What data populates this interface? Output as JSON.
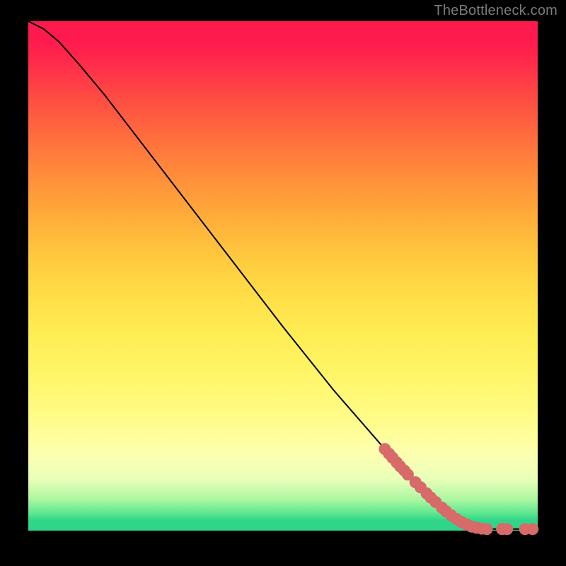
{
  "watermark": "TheBottleneck.com",
  "colors": {
    "curve": "#000000",
    "point_fill": "#d86a6a",
    "point_stroke": "#d86a6a",
    "background_black": "#000000"
  },
  "chart_data": {
    "type": "line",
    "title": "",
    "xlabel": "",
    "ylabel": "",
    "xlim": [
      0,
      100
    ],
    "ylim": [
      0,
      100
    ],
    "grid": false,
    "legend": false,
    "curve": [
      {
        "x": 0,
        "y": 100
      },
      {
        "x": 3,
        "y": 98.5
      },
      {
        "x": 6,
        "y": 96.0
      },
      {
        "x": 10,
        "y": 91.5
      },
      {
        "x": 15,
        "y": 85.5
      },
      {
        "x": 20,
        "y": 79.0
      },
      {
        "x": 30,
        "y": 66.0
      },
      {
        "x": 40,
        "y": 53.0
      },
      {
        "x": 50,
        "y": 40.0
      },
      {
        "x": 60,
        "y": 27.5
      },
      {
        "x": 70,
        "y": 16.0
      },
      {
        "x": 78,
        "y": 7.5
      },
      {
        "x": 83,
        "y": 3.0
      },
      {
        "x": 86,
        "y": 1.3
      },
      {
        "x": 88,
        "y": 0.6
      },
      {
        "x": 90,
        "y": 0.3
      },
      {
        "x": 100,
        "y": 0.3
      }
    ],
    "points": [
      {
        "x": 70.0,
        "y": 16.0
      },
      {
        "x": 70.8,
        "y": 15.1
      },
      {
        "x": 71.5,
        "y": 14.3
      },
      {
        "x": 72.3,
        "y": 13.4
      },
      {
        "x": 73.0,
        "y": 12.6
      },
      {
        "x": 73.8,
        "y": 11.8
      },
      {
        "x": 74.5,
        "y": 11.0
      },
      {
        "x": 76.0,
        "y": 9.5
      },
      {
        "x": 77.0,
        "y": 8.5
      },
      {
        "x": 78.2,
        "y": 7.3
      },
      {
        "x": 79.0,
        "y": 6.5
      },
      {
        "x": 80.0,
        "y": 5.6
      },
      {
        "x": 81.2,
        "y": 4.5
      },
      {
        "x": 82.0,
        "y": 3.8
      },
      {
        "x": 83.0,
        "y": 3.0
      },
      {
        "x": 84.0,
        "y": 2.3
      },
      {
        "x": 85.0,
        "y": 1.7
      },
      {
        "x": 86.0,
        "y": 1.2
      },
      {
        "x": 87.0,
        "y": 0.8
      },
      {
        "x": 88.0,
        "y": 0.55
      },
      {
        "x": 89.0,
        "y": 0.4
      },
      {
        "x": 90.0,
        "y": 0.3
      },
      {
        "x": 93.0,
        "y": 0.3
      },
      {
        "x": 94.0,
        "y": 0.3
      },
      {
        "x": 97.5,
        "y": 0.3
      },
      {
        "x": 99.0,
        "y": 0.3
      }
    ],
    "point_radius": 8
  }
}
